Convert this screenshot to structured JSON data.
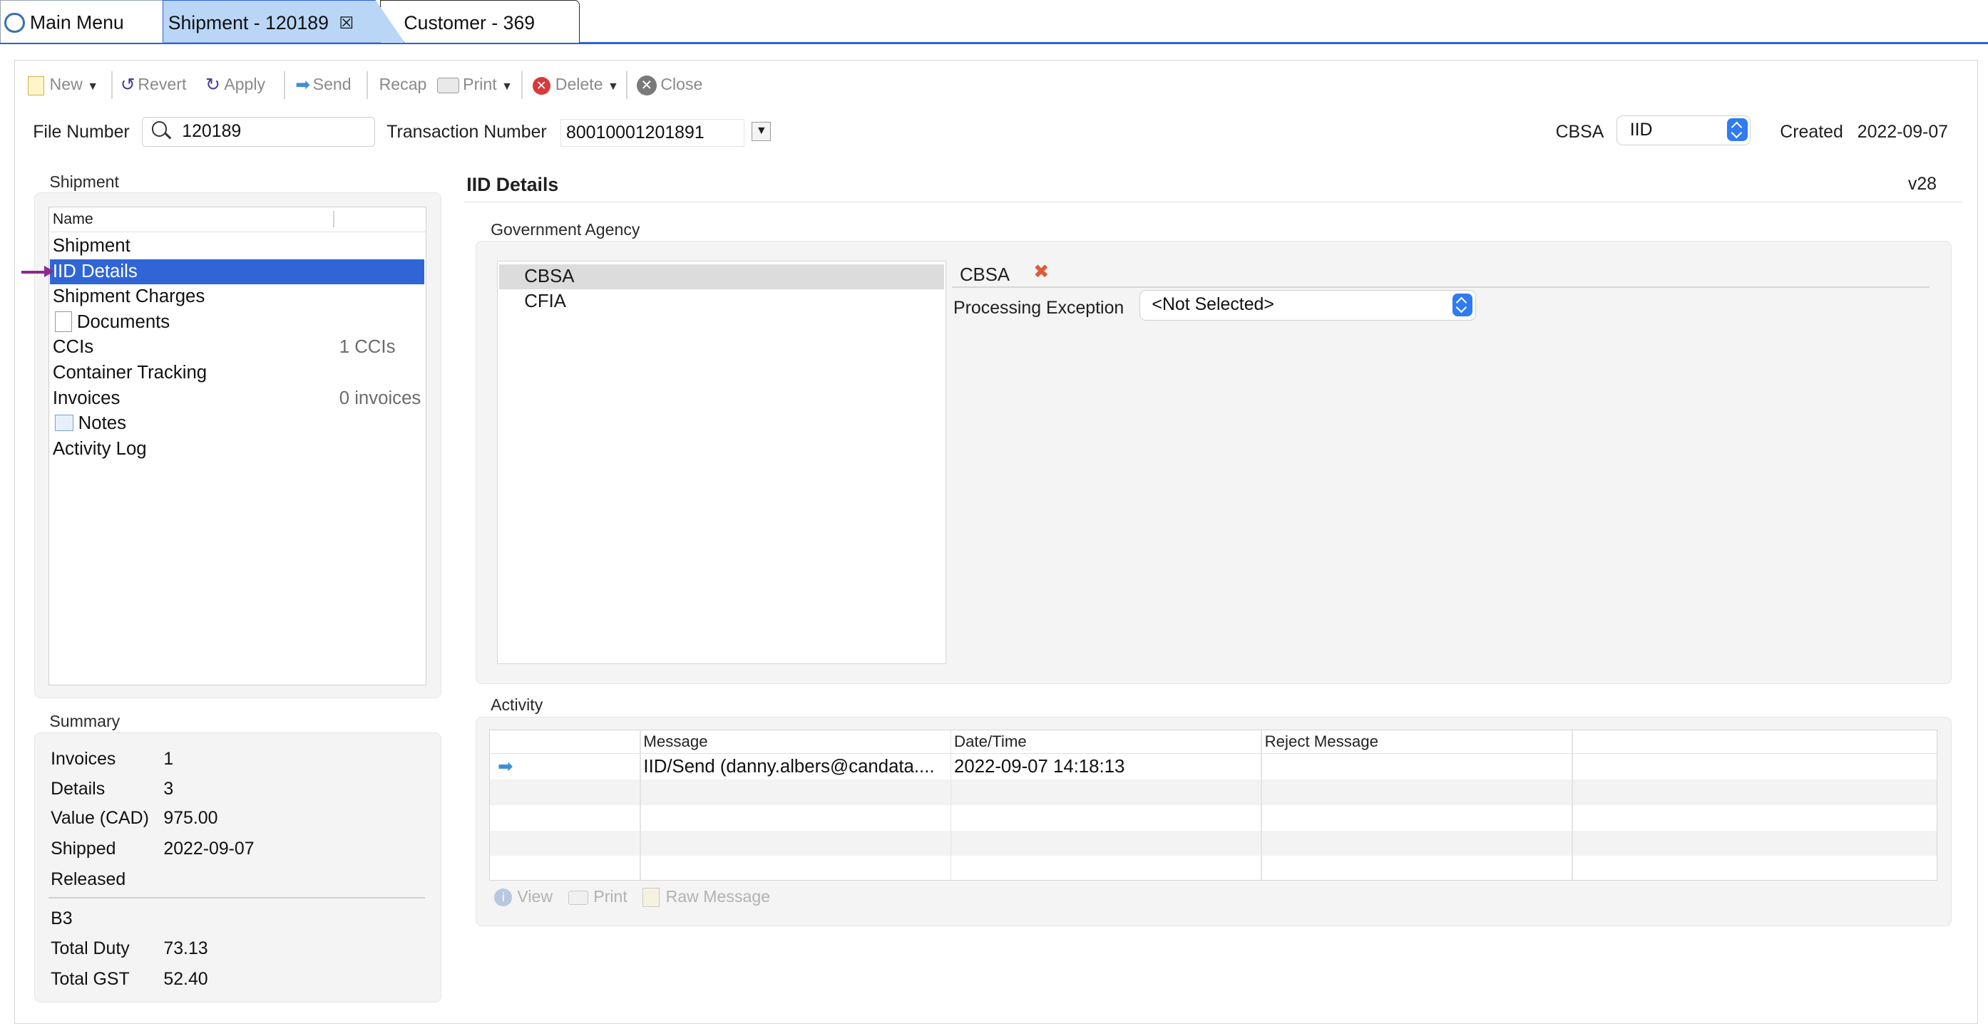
{
  "tabs": [
    {
      "label": "Main Menu"
    },
    {
      "label": "Shipment - 120189"
    },
    {
      "label": "Customer - 369"
    }
  ],
  "toolbar": {
    "new": "New",
    "revert": "Revert",
    "apply": "Apply",
    "send": "Send",
    "recap": "Recap",
    "print": "Print",
    "delete": "Delete",
    "close": "Close"
  },
  "header": {
    "file_number_label": "File Number",
    "file_number": "120189",
    "transaction_label": "Transaction Number",
    "transaction_number": "80010001201891",
    "agency_label": "CBSA",
    "agency_select": "IID",
    "created_label": "Created",
    "created_date": "2022-09-07"
  },
  "shipment_panel": {
    "title": "Shipment",
    "column": "Name",
    "items": [
      {
        "label": "Shipment",
        "count": ""
      },
      {
        "label": "IID Details",
        "count": ""
      },
      {
        "label": "Shipment Charges",
        "count": ""
      },
      {
        "label": "Documents",
        "count": ""
      },
      {
        "label": "CCIs",
        "count": "1 CCIs"
      },
      {
        "label": "Container Tracking",
        "count": ""
      },
      {
        "label": "Invoices",
        "count": "0 invoices"
      },
      {
        "label": "Notes",
        "count": ""
      },
      {
        "label": "Activity Log",
        "count": ""
      }
    ],
    "selected_index": 1
  },
  "summary": {
    "title": "Summary",
    "rows": [
      {
        "label": "Invoices",
        "value": "1"
      },
      {
        "label": "Details",
        "value": "3"
      },
      {
        "label": "Value (CAD)",
        "value": "975.00"
      },
      {
        "label": "Shipped",
        "value": "2022-09-07"
      },
      {
        "label": "Released",
        "value": ""
      }
    ],
    "section2_title": "B3",
    "rows2": [
      {
        "label": "Total Duty",
        "value": "73.13"
      },
      {
        "label": "Total GST",
        "value": "52.40"
      }
    ]
  },
  "details": {
    "title": "IID Details",
    "version": "v28",
    "gov_agency_title": "Government Agency",
    "agencies": [
      "CBSA",
      "CFIA"
    ],
    "selected_agency": "CBSA",
    "editor_title": "CBSA",
    "processing_exception_label": "Processing Exception",
    "processing_exception_value": "<Not Selected>"
  },
  "activity": {
    "title": "Activity",
    "columns": [
      "",
      "Message",
      "Date/Time",
      "Reject Message",
      ""
    ],
    "rows": [
      {
        "icon": "arrow-right-icon",
        "message": "IID/Send (danny.albers@candata....",
        "datetime": "2022-09-07 14:18:13",
        "reject": ""
      }
    ],
    "buttons": {
      "view": "View",
      "print": "Print",
      "raw": "Raw Message"
    }
  },
  "colors": {
    "accent": "#2f65d6",
    "selected_tab": "#b9d6f6",
    "annotation_arrow": "#8e2a8e"
  }
}
